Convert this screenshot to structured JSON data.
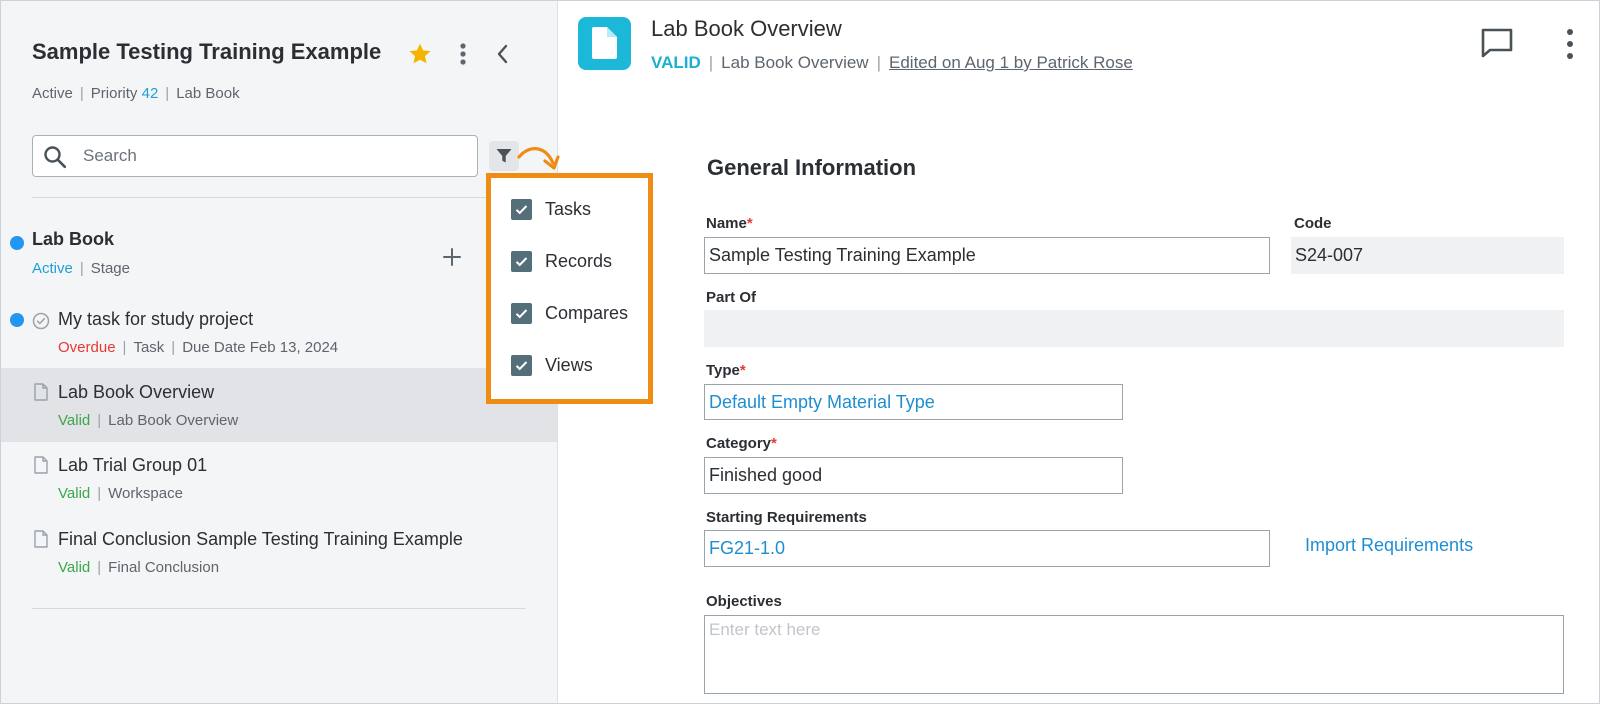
{
  "project": {
    "title": "Sample Testing Training Example",
    "status": "Active",
    "priority_label": "Priority",
    "priority_value": "42",
    "type": "Lab Book"
  },
  "search": {
    "placeholder": "Search"
  },
  "filter_options": [
    {
      "label": "Tasks",
      "checked": true
    },
    {
      "label": "Records",
      "checked": true
    },
    {
      "label": "Compares",
      "checked": true
    },
    {
      "label": "Views",
      "checked": true
    }
  ],
  "tree": [
    {
      "title": "Lab Book",
      "status": "Active",
      "kind": "Stage"
    },
    {
      "title": "My task for study project",
      "status": "Overdue",
      "kind": "Task",
      "extra": "Due Date Feb 13, 2024"
    },
    {
      "title": "Lab Book Overview",
      "status": "Valid",
      "kind": "Lab Book Overview"
    },
    {
      "title": "Lab Trial Group 01",
      "status": "Valid",
      "kind": "Workspace"
    },
    {
      "title": "Final Conclusion Sample Testing Training Example",
      "status": "Valid",
      "kind": "Final Conclusion"
    }
  ],
  "document": {
    "title": "Lab Book Overview",
    "status": "VALID",
    "type": "Lab Book Overview",
    "edited": "Edited on Aug 1 by Patrick Rose"
  },
  "form": {
    "section_title": "General Information",
    "name_label": "Name",
    "name_value": "Sample Testing Training Example",
    "code_label": "Code",
    "code_value": "S24-007",
    "part_of_label": "Part Of",
    "part_of_value": "",
    "type_label": "Type",
    "type_value": "Default Empty Material Type",
    "category_label": "Category",
    "category_value": "Finished good",
    "starting_req_label": "Starting Requirements",
    "starting_req_value": "FG21-1.0",
    "import_link": "Import Requirements",
    "objectives_label": "Objectives",
    "objectives_placeholder": "Enter text here",
    "required_mark": "*"
  },
  "colors": {
    "accent_blue": "#1f9fd6",
    "valid_green": "#3ba64a",
    "overdue_red": "#e53935",
    "highlight_orange": "#ef8c14",
    "doc_badge": "#1cb8d9",
    "star": "#f5b400"
  }
}
